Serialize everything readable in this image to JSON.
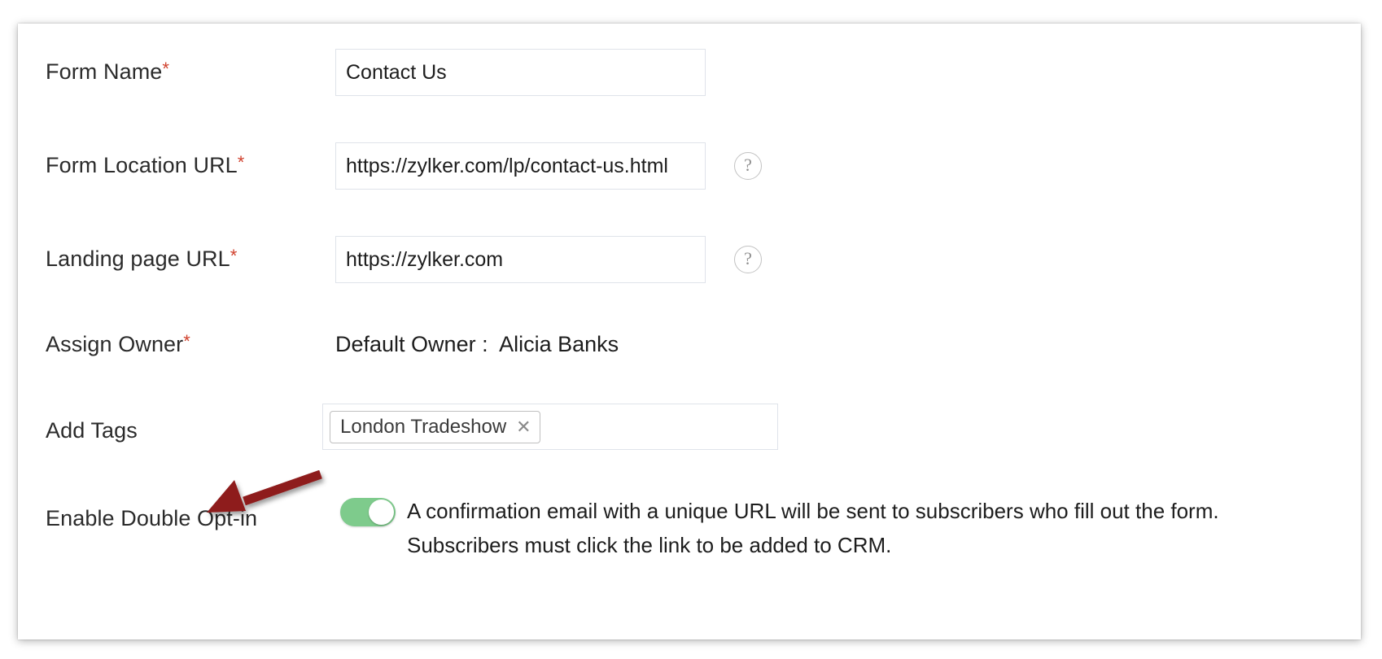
{
  "form": {
    "fields": [
      {
        "label": "Form Name",
        "required": true,
        "required_mark": "*",
        "value": "Contact Us",
        "placeholder": "",
        "help_icon": false
      },
      {
        "label": "Form Location URL",
        "required": true,
        "required_mark": "*",
        "value": "https://zylker.com/lp/contact-us.html",
        "placeholder": "",
        "help_icon": true,
        "help_icon_glyph": "?"
      },
      {
        "label": "Landing page URL",
        "required": true,
        "required_mark": "*",
        "value": "https://zylker.com",
        "placeholder": "",
        "help_icon": true,
        "help_icon_glyph": "?"
      }
    ],
    "assign_owner": {
      "label": "Assign Owner",
      "required_mark": "*",
      "value": "Default Owner :  Alicia Banks"
    },
    "add_tags": {
      "label": "Add Tags",
      "tags": [
        {
          "text": "London Tradeshow",
          "remove_glyph": "✕"
        }
      ]
    },
    "double_optin": {
      "label": "Enable Double Opt-in",
      "toggle_state": "on",
      "description": "A confirmation email with a unique URL will be sent to subscribers who fill out the form.\nSubscribers must click the link to be added to CRM."
    }
  },
  "colors": {
    "required_asterisk": "#d0402c",
    "toggle_on": "#7ecb8c",
    "field_border": "#dfe3ea",
    "tag_border": "#bfbfbf",
    "annotation_arrow": "#8e1b1b",
    "text": "#1d1d1d"
  }
}
